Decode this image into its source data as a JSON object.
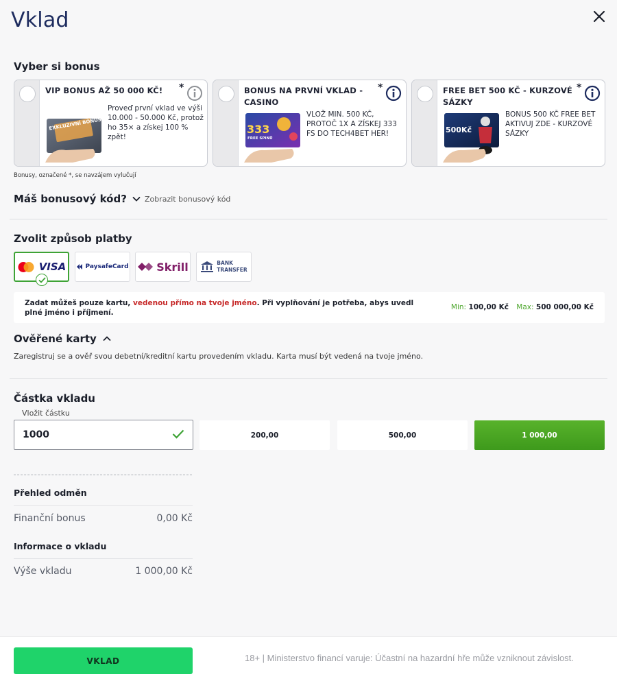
{
  "header": {
    "title": "Vklad"
  },
  "bonus": {
    "title": "Vyber si bonus",
    "cards": [
      {
        "title": "VIP BONUS AŽ 50 000 KČ!",
        "star": "*",
        "desc": "Proveď první vklad ve výši 10.000 - 50.000 Kč, protož ho 35× a získej 100 % zpět!",
        "image_label": "EXKLUZIVNÍ BONUS"
      },
      {
        "title": "BONUS NA PRVNÍ VKLAD - CASINO",
        "star": "*",
        "desc": "VLOŽ MIN. 500 KČ, PROTOČ 1X A ZÍSKEJ 333 FS DO TECH4BET HER!",
        "image_label": "333",
        "image_sub": "FREE SPINŮ"
      },
      {
        "title": "FREE BET 500 KČ - KURZOVÉ SÁZKY",
        "star": "*",
        "desc": "BONUS 500 KČ FREE BET AKTIVUJ ZDE - KURZOVÉ SÁZKY",
        "image_label": "500Kč"
      }
    ],
    "note": "Bonusy, označené *, se navzájem vylučují"
  },
  "promo": {
    "question": "Máš bonusový kód?",
    "link": "Zobrazit bonusový kód"
  },
  "payment": {
    "title": "Zvolit způsob platby",
    "methods": [
      {
        "label": "VISA",
        "sub": "mastercard",
        "selected": true
      },
      {
        "label": "PaysafeCard",
        "selected": false
      },
      {
        "label": "Skrill",
        "selected": false
      },
      {
        "label": "BANK",
        "label2": "TRANSFER",
        "selected": false
      }
    ],
    "notice_part1": "Zadat můžeš pouze kartu, ",
    "notice_red": "vedenou přímo na tvoje jméno",
    "notice_part2": ". Při vyplňování je potřeba, abys uvedl plné jméno i příjmení.",
    "min_label": "Min:",
    "min_value": "100,00 Kč",
    "max_label": "Max:",
    "max_value": "500 000,00 Kč"
  },
  "verified": {
    "title": "Ověřené karty",
    "desc": "Zaregistruj se a ověř svou debetní/kreditní kartu provedením vkladu. Karta musí být vedená na tvoje jméno."
  },
  "amount": {
    "title": "Částka vkladu",
    "label": "Vložit částku",
    "value": "1000",
    "chips": [
      "200,00",
      "500,00",
      "1 000,00"
    ],
    "active_chip": 2
  },
  "summary": {
    "rewards_title": "Přehled odměn",
    "financial_bonus_label": "Finanční bonus",
    "financial_bonus_value": "0,00 Kč",
    "info_title": "Informace o vkladu",
    "deposit_label": "Výše vkladu",
    "deposit_value": "1 000,00 Kč"
  },
  "footer": {
    "button": "VKLAD",
    "legal": "18+ | Ministerstvo financí varuje: Účastní na hazardní hře může vzniknout závislost."
  },
  "colors": {
    "accent_green": "#1fd36a",
    "chip_green": "#4aa824",
    "title_blue": "#1d2b5e",
    "warning_red": "#c62828"
  }
}
